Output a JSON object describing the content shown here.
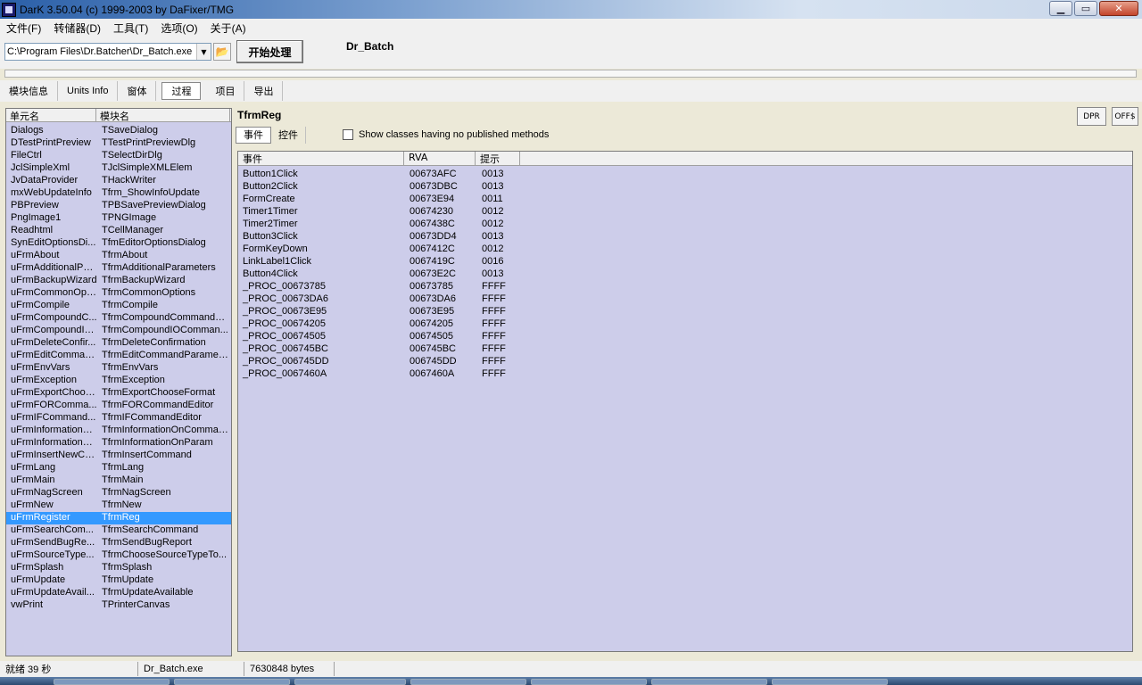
{
  "window": {
    "title": "DarK 3.50.04 (c) 1999-2003 by DaFixer/TMG"
  },
  "menu": [
    "文件(F)",
    "转储器(D)",
    "工具(T)",
    "选项(O)",
    "关于(A)"
  ],
  "toolbar": {
    "path_value": "C:\\Program Files\\Dr.Batcher\\Dr_Batch.exe",
    "start_label": "开始处理",
    "file_label": "Dr_Batch"
  },
  "tabs": [
    "模块信息",
    "Units Info",
    "窗体",
    "过程",
    "项目",
    "导出"
  ],
  "left": {
    "headers": [
      "单元名",
      "模块名"
    ],
    "rows": [
      [
        "Dialogs",
        "TSaveDialog"
      ],
      [
        "DTestPrintPreview",
        "TTestPrintPreviewDlg"
      ],
      [
        "FileCtrl",
        "TSelectDirDlg"
      ],
      [
        "JclSimpleXml",
        "TJclSimpleXMLElem"
      ],
      [
        "JvDataProvider",
        "THackWriter"
      ],
      [
        "mxWebUpdateInfo",
        "Tfrm_ShowInfoUpdate"
      ],
      [
        "PBPreview",
        "TPBSavePreviewDialog"
      ],
      [
        "PngImage1",
        "TPNGImage"
      ],
      [
        "Readhtml",
        "TCellManager"
      ],
      [
        "SynEditOptionsDi...",
        "TfmEditorOptionsDialog"
      ],
      [
        "uFrmAbout",
        "TfrmAbout"
      ],
      [
        "uFrmAdditionalPar...",
        "TfrmAdditionalParameters"
      ],
      [
        "uFrmBackupWizard",
        "TfrmBackupWizard"
      ],
      [
        "uFrmCommonOpti...",
        "TfrmCommonOptions"
      ],
      [
        "uFrmCompile",
        "TfrmCompile"
      ],
      [
        "uFrmCompoundC...",
        "TfrmCompoundCommandE..."
      ],
      [
        "uFrmCompoundIO...",
        "TfrmCompoundIOComman..."
      ],
      [
        "uFrmDeleteConfir...",
        "TfrmDeleteConfirmation"
      ],
      [
        "uFrmEditComman...",
        "TfrmEditCommandParamet..."
      ],
      [
        "uFrmEnvVars",
        "TfrmEnvVars"
      ],
      [
        "uFrmException",
        "TfrmException"
      ],
      [
        "uFrmExportChoos...",
        "TfrmExportChooseFormat"
      ],
      [
        "uFrmFORComma...",
        "TfrmFORCommandEditor"
      ],
      [
        "uFrmIFCommand...",
        "TfrmIFCommandEditor"
      ],
      [
        "uFrmInformationO...",
        "TfrmInformationOnCommand"
      ],
      [
        "uFrmInformationO...",
        "TfrmInformationOnParam"
      ],
      [
        "uFrmInsertNewCo...",
        "TfrmInsertCommand"
      ],
      [
        "uFrmLang",
        "TfrmLang"
      ],
      [
        "uFrmMain",
        "TfrmMain"
      ],
      [
        "uFrmNagScreen",
        "TfrmNagScreen"
      ],
      [
        "uFrmNew",
        "TfrmNew"
      ],
      [
        "uFrmRegister",
        "TfrmReg"
      ],
      [
        "uFrmSearchCom...",
        "TfrmSearchCommand"
      ],
      [
        "uFrmSendBugRe...",
        "TfrmSendBugReport"
      ],
      [
        "uFrmSourceType...",
        "TfrmChooseSourceTypeTo..."
      ],
      [
        "uFrmSplash",
        "TfrmSplash"
      ],
      [
        "uFrmUpdate",
        "TfrmUpdate"
      ],
      [
        "uFrmUpdateAvail...",
        "TfrmUpdateAvailable"
      ],
      [
        "vwPrint",
        "TPrinterCanvas"
      ]
    ],
    "selected_index": 31
  },
  "right": {
    "title": "TfrmReg",
    "subtabs": [
      "事件",
      "控件"
    ],
    "checkbox_label": "Show classes having no published methods",
    "side_buttons": [
      "DPR",
      "OFF$"
    ],
    "headers": [
      "事件",
      "RVA",
      "提示"
    ],
    "rows": [
      [
        "Button1Click",
        "00673AFC",
        "0013"
      ],
      [
        "Button2Click",
        "00673DBC",
        "0013"
      ],
      [
        "FormCreate",
        "00673E94",
        "0011"
      ],
      [
        "Timer1Timer",
        "00674230",
        "0012"
      ],
      [
        "Timer2Timer",
        "0067438C",
        "0012"
      ],
      [
        "Button3Click",
        "00673DD4",
        "0013"
      ],
      [
        "FormKeyDown",
        "0067412C",
        "0012"
      ],
      [
        "LinkLabel1Click",
        "0067419C",
        "0016"
      ],
      [
        "Button4Click",
        "00673E2C",
        "0013"
      ],
      [
        "_PROC_00673785",
        "00673785",
        "FFFF"
      ],
      [
        "_PROC_00673DA6",
        "00673DA6",
        "FFFF"
      ],
      [
        "_PROC_00673E95",
        "00673E95",
        "FFFF"
      ],
      [
        "_PROC_00674205",
        "00674205",
        "FFFF"
      ],
      [
        "_PROC_00674505",
        "00674505",
        "FFFF"
      ],
      [
        "_PROC_006745BC",
        "006745BC",
        "FFFF"
      ],
      [
        "_PROC_006745DD",
        "006745DD",
        "FFFF"
      ],
      [
        "_PROC_0067460A",
        "0067460A",
        "FFFF"
      ]
    ]
  },
  "status": {
    "ready": "就绪 39 秒",
    "file": "Dr_Batch.exe",
    "size": "7630848 bytes"
  }
}
